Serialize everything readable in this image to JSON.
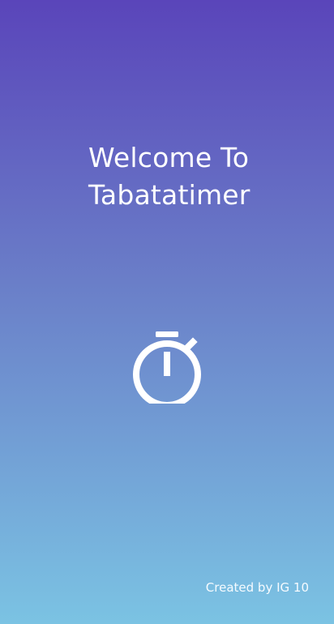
{
  "welcome": {
    "line1": "Welcome To",
    "line2": "Tabatatimer"
  },
  "icons": {
    "timer": "stopwatch-icon"
  },
  "footer": {
    "credit": "Created by IG 10"
  },
  "colors": {
    "gradient_top": "#5a45ba",
    "gradient_middle": "#6a7ec8",
    "gradient_bottom": "#7bc3e3",
    "foreground": "#ffffff"
  }
}
